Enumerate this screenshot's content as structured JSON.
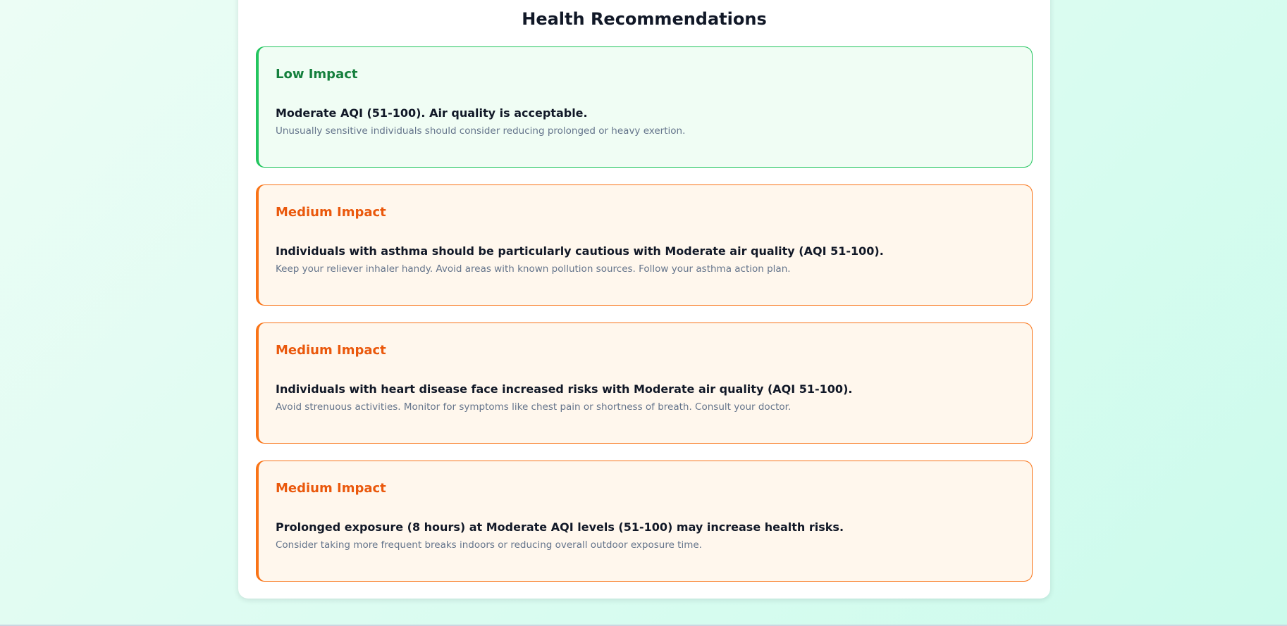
{
  "section": {
    "title": "Health Recommendations"
  },
  "recommendations": [
    {
      "level": "low",
      "impact": "Low Impact",
      "headline": "Moderate AQI (51-100). Air quality is acceptable.",
      "detail": "Unusually sensitive individuals should consider reducing prolonged or heavy exertion."
    },
    {
      "level": "medium",
      "impact": "Medium Impact",
      "headline": "Individuals with asthma should be particularly cautious with Moderate air quality (AQI 51-100).",
      "detail": "Keep your reliever inhaler handy. Avoid areas with known pollution sources. Follow your asthma action plan."
    },
    {
      "level": "medium",
      "impact": "Medium Impact",
      "headline": "Individuals with heart disease face increased risks with Moderate air quality (AQI 51-100).",
      "detail": "Avoid strenuous activities. Monitor for symptoms like chest pain or shortness of breath. Consult your doctor."
    },
    {
      "level": "medium",
      "impact": "Medium Impact",
      "headline": "Prolonged exposure (8 hours) at Moderate AQI levels (51-100) may increase health risks.",
      "detail": "Consider taking more frequent breaks indoors or reducing overall outdoor exposure time."
    }
  ],
  "colors": {
    "low_accent": "#22c55e",
    "low_text": "#15803d",
    "medium_accent": "#f97316",
    "medium_text": "#ea580c"
  }
}
